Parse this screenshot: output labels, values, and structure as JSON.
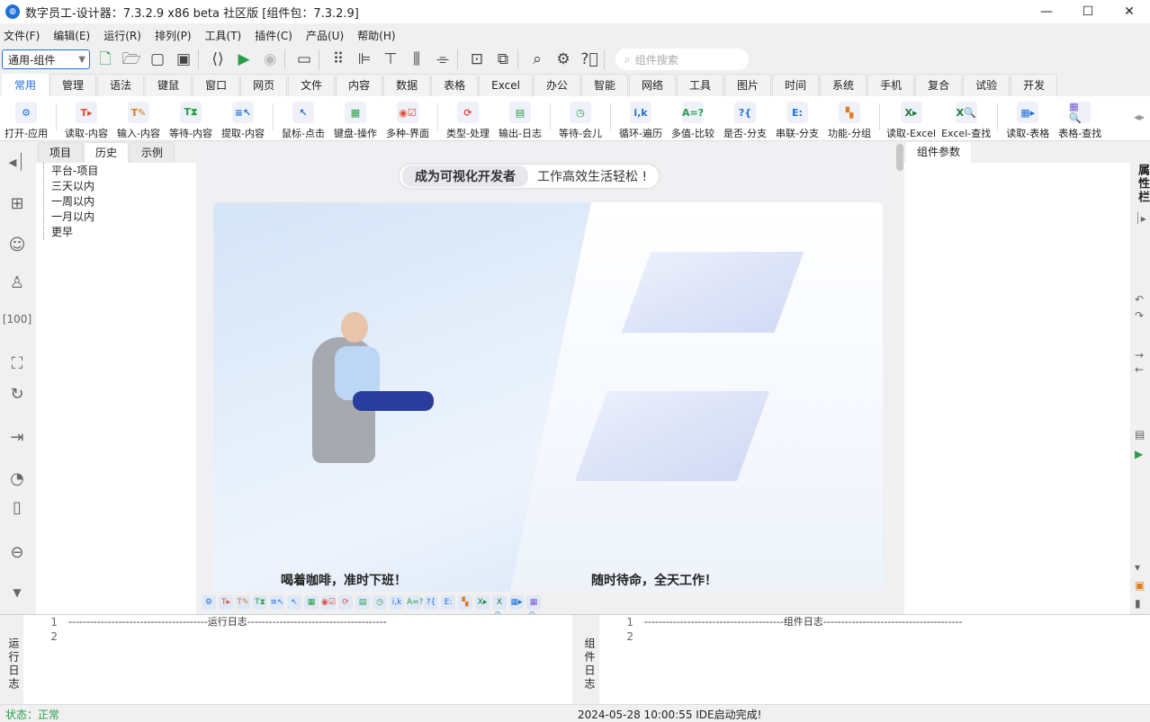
{
  "window": {
    "title": "数字员工-设计器：7.3.2.9 x86 beta 社区版 [组件包：7.3.2.9]",
    "minimize": "—",
    "maximize": "☐",
    "close": "✕"
  },
  "menu": [
    "文件(F)",
    "编辑(E)",
    "运行(R)",
    "排列(P)",
    "工具(T)",
    "插件(C)",
    "产品(U)",
    "帮助(H)"
  ],
  "toolbar": {
    "combo_value": "通用-组件",
    "search_placeholder": "组件搜索"
  },
  "tabs": [
    "常用",
    "管理",
    "语法",
    "键鼠",
    "窗口",
    "网页",
    "文件",
    "内容",
    "数据",
    "表格",
    "Excel",
    "办公",
    "智能",
    "网络",
    "工具",
    "图片",
    "时间",
    "系统",
    "手机",
    "复合",
    "试验",
    "开发"
  ],
  "active_tab": "常用",
  "components": [
    {
      "label": "打开-应用",
      "icon": "⚙",
      "color": "#1e6fd9"
    },
    {
      "sep": true
    },
    {
      "label": "读取-内容",
      "icon": "T▸",
      "color": "#e04a3a"
    },
    {
      "label": "输入-内容",
      "icon": "T✎",
      "color": "#e07a1a"
    },
    {
      "label": "等待-内容",
      "icon": "T⧗",
      "color": "#2a9d4a"
    },
    {
      "label": "提取-内容",
      "icon": "≡↖",
      "color": "#1e6fd9"
    },
    {
      "sep": true
    },
    {
      "label": "鼠标-点击",
      "icon": "↖",
      "color": "#1e6fd9"
    },
    {
      "label": "键盘-操作",
      "icon": "▦",
      "color": "#2a9d4a"
    },
    {
      "label": "多种-界面",
      "icon": "◉☑",
      "color": "#e04a3a"
    },
    {
      "sep": true
    },
    {
      "label": "类型-处理",
      "icon": "⟳",
      "color": "#e04a3a"
    },
    {
      "label": "输出-日志",
      "icon": "▤",
      "color": "#2a9d4a"
    },
    {
      "sep": true
    },
    {
      "label": "等待-会儿",
      "icon": "◷",
      "color": "#2a9d4a"
    },
    {
      "sep": true
    },
    {
      "label": "循环-遍历",
      "icon": "i,k",
      "color": "#1e6fd9"
    },
    {
      "label": "多值-比较",
      "icon": "A=?",
      "color": "#2a9d4a"
    },
    {
      "label": "是否-分支",
      "icon": "?{",
      "color": "#1e6fd9"
    },
    {
      "label": "串联-分支",
      "icon": "E:",
      "color": "#1e6fd9"
    },
    {
      "label": "功能-分组",
      "icon": "▚",
      "color": "#e07a1a"
    },
    {
      "sep": true
    },
    {
      "label": "读取-Excel",
      "icon": "X▸",
      "color": "#1f7a3a"
    },
    {
      "label": "Excel-查找",
      "icon": "X🔍",
      "color": "#1f7a3a"
    },
    {
      "sep": true
    },
    {
      "label": "读取-表格",
      "icon": "▦▸",
      "color": "#1e6fd9"
    },
    {
      "label": "表格-查找",
      "icon": "▦🔍",
      "color": "#7a5ad9"
    }
  ],
  "left_panel": {
    "tabs": [
      "项目",
      "历史",
      "示例"
    ],
    "active_tab": "历史",
    "tree": [
      "平台-项目",
      "三天以内",
      "一周以内",
      "一月以内",
      "更早"
    ]
  },
  "canvas": {
    "slogan_bold": "成为可视化开发者",
    "slogan_text": "工作高效生活轻松 !",
    "caption_left": "喝着咖啡，准时下班！",
    "caption_right": "随时待命，全天工作！"
  },
  "right_panel": {
    "tab": "组件参数",
    "side_label": "属性栏"
  },
  "logs": {
    "run_side": "运行日志",
    "run_lines": [
      "1",
      "2"
    ],
    "run_text": "---------------------------------------运行日志---------------------------------------",
    "comp_side": "组件日志",
    "comp_lines": [
      "1",
      "2"
    ],
    "comp_text": "---------------------------------------组件日志---------------------------------------"
  },
  "status": {
    "state": "状态：正常",
    "message": "2024-05-28 10:00:55 IDE启动完成!",
    "state_color": "#2a9d4a"
  }
}
